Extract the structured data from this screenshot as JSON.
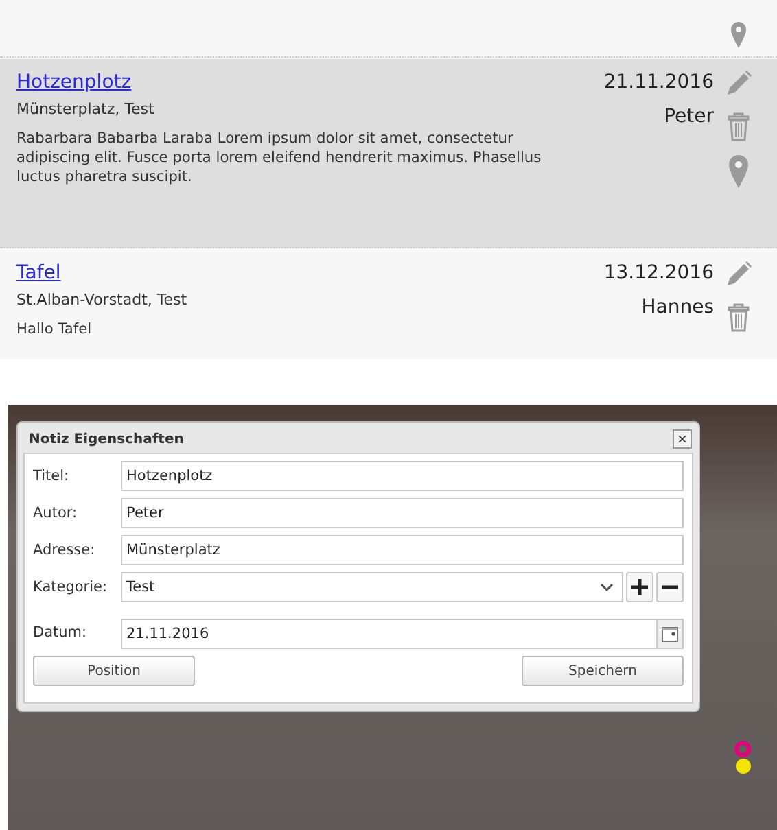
{
  "notes": [
    {
      "selected": false,
      "actions": [
        {
          "kind": "pin"
        }
      ]
    },
    {
      "title": "Hotzenplotz",
      "address": "Münsterplatz, Test",
      "date": "21.11.2016",
      "author": "Peter",
      "text": "Rabarbara Babarba Laraba Lorem ipsum dolor sit amet, consectetur adipiscing elit. Fusce porta lorem eleifend hendrerit maximus. Phasellus luctus pharetra suscipit.",
      "selected": true,
      "actions": [
        {
          "kind": "edit"
        },
        {
          "kind": "delete"
        },
        {
          "kind": "pin"
        }
      ]
    },
    {
      "title": "Tafel",
      "address": "St.Alban-Vorstadt, Test",
      "date": "13.12.2016",
      "author": "Hannes",
      "text": "Hallo Tafel",
      "selected": false,
      "actions": [
        {
          "kind": "edit"
        },
        {
          "kind": "delete"
        }
      ]
    }
  ],
  "dialog": {
    "title": "Notiz Eigenschaften",
    "close": "×",
    "fields": [
      {
        "label": "Titel:",
        "value": "Hotzenplotz",
        "kind": "text"
      },
      {
        "label": "Autor:",
        "value": "Peter",
        "kind": "text"
      },
      {
        "label": "Adresse:",
        "value": "Münsterplatz",
        "kind": "text"
      },
      {
        "label": "Kategorie:",
        "value": "Test",
        "kind": "select"
      },
      {
        "label": "Datum:",
        "value": "21.11.2016",
        "kind": "date"
      }
    ],
    "buttons": [
      "Position",
      "Speichern"
    ]
  },
  "markers": [
    {
      "color": "#e6007e",
      "kind": "ring"
    },
    {
      "color": "#f5e400",
      "kind": "dot"
    }
  ]
}
